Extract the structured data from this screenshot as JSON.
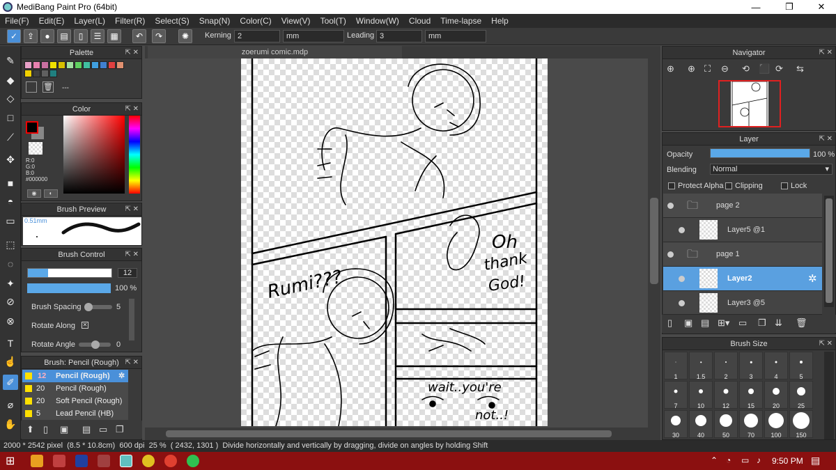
{
  "window": {
    "title": "MediBang Paint Pro (64bit)"
  },
  "menu": [
    "File(F)",
    "Edit(E)",
    "Layer(L)",
    "Filter(R)",
    "Select(S)",
    "Snap(N)",
    "Color(C)",
    "View(V)",
    "Tool(T)",
    "Window(W)",
    "Cloud",
    "Time-lapse",
    "Help"
  ],
  "toolbar": {
    "kerning_label": "Kerning",
    "kerning_value": "2",
    "kerning_unit": "mm",
    "leading_label": "Leading",
    "leading_value": "3",
    "leading_unit": "mm"
  },
  "palette": {
    "title": "Palette",
    "row1": [
      "#e8a0c8",
      "#e880b0",
      "#c870a0",
      "#f0e000",
      "#d8c000",
      "#a0e0a0",
      "#60d060",
      "#40c0a0",
      "#40a0e0",
      "#4080d0",
      "#e04040",
      "#e09070"
    ],
    "row2": [
      "#f0d000",
      "#404040",
      "#606060",
      "#208080"
    ],
    "name": "---"
  },
  "color": {
    "title": "Color",
    "r": "R:0",
    "g": "G:0",
    "b": "B:0",
    "hex": "#000000"
  },
  "brush_preview": {
    "title": "Brush Preview",
    "size": "0.51mm"
  },
  "brush_control": {
    "title": "Brush Control",
    "size_value": "12",
    "opacity_value": "100 %",
    "spacing_label": "Brush Spacing",
    "spacing_value": "5",
    "rotate_along_label": "Rotate Along",
    "rotate_angle_label": "Rotate Angle",
    "rotate_angle_value": "0"
  },
  "brush_list": {
    "title": "Brush: Pencil (Rough)",
    "items": [
      {
        "size": "12",
        "name": "Pencil (Rough)"
      },
      {
        "size": "20",
        "name": "Pencil (Rough)"
      },
      {
        "size": "20",
        "name": "Soft Pencil (Rough)"
      },
      {
        "size": "5",
        "name": "Lead Pencil (HB)"
      }
    ]
  },
  "canvas": {
    "tab": "zoerumi comic.mdp",
    "texts": [
      "Rumi???",
      "Oh",
      "thank",
      "God!",
      "wait..you're",
      "not..!"
    ]
  },
  "navigator": {
    "title": "Navigator"
  },
  "layer": {
    "title": "Layer",
    "opacity_label": "Opacity",
    "opacity_value": "100 %",
    "opacity_level": 1.0,
    "blending_label": "Blending",
    "blending_value": "Normal",
    "protect_alpha": "Protect Alpha",
    "clipping": "Clipping",
    "lock": "Lock",
    "items": [
      {
        "name": "page 2"
      },
      {
        "name": "Layer5 @1"
      },
      {
        "name": "page 1"
      },
      {
        "name": "Layer2"
      },
      {
        "name": "Layer3 @5"
      }
    ]
  },
  "brush_size": {
    "title": "Brush Size",
    "sizes": [
      "1",
      "1.5",
      "2",
      "3",
      "4",
      "5",
      "7",
      "10",
      "12",
      "15",
      "20",
      "25",
      "30",
      "40",
      "50",
      "70",
      "100",
      "150"
    ]
  },
  "status": {
    "dimensions": "2000 * 2542 pixel",
    "physical": "(8.5 * 10.8cm)",
    "dpi": "600 dpi",
    "zoom": "25 %",
    "coords": "( 2432, 1301 )",
    "hint": "Divide horizontally and vertically by dragging, divide on angles  by holding Shift"
  },
  "taskbar": {
    "time": "9:50 PM"
  }
}
